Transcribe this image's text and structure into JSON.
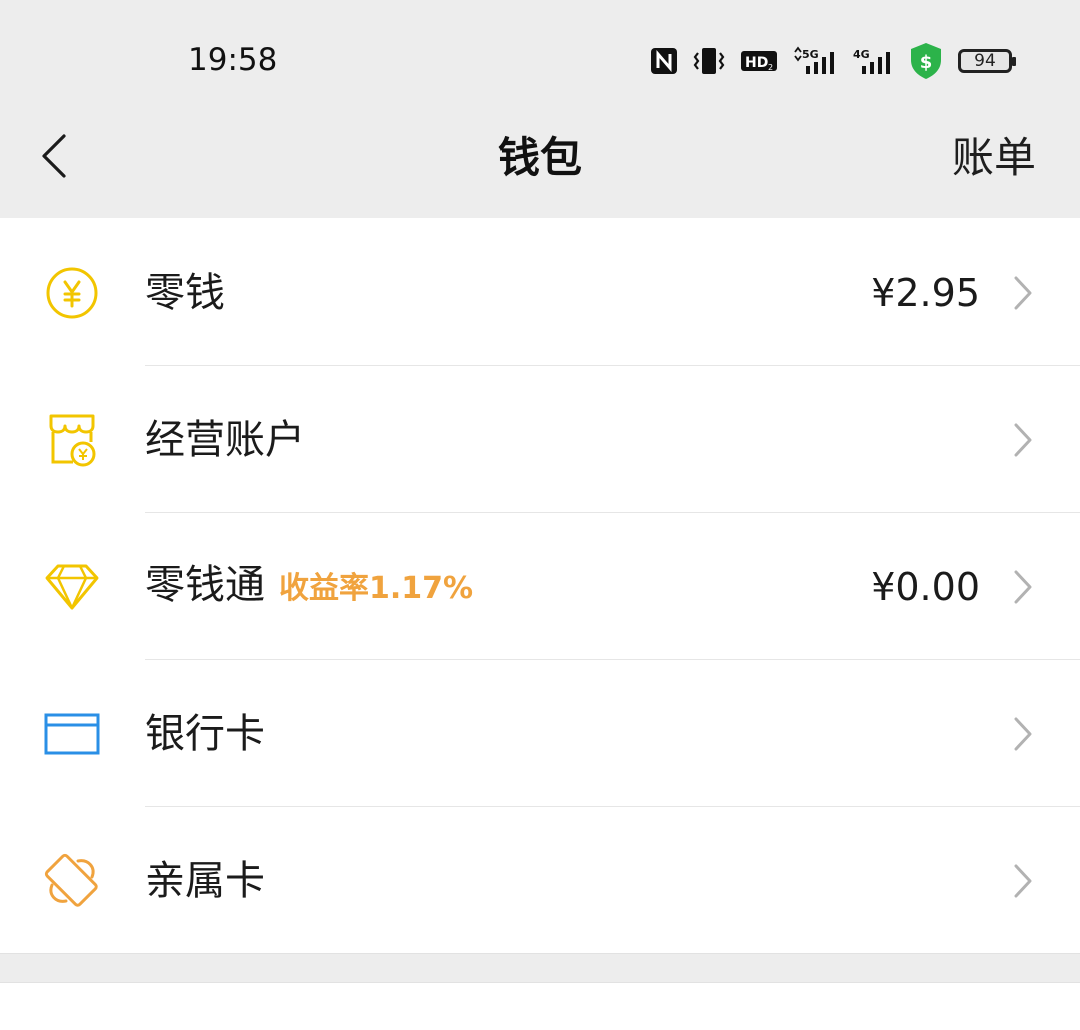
{
  "status_bar": {
    "time": "19:58",
    "icons": [
      "nfc-icon",
      "vibrate-icon",
      "hd-icon",
      "5g-signal-icon",
      "4g-signal-icon",
      "shield-dollar-icon",
      "battery-icon"
    ],
    "battery_level": "94",
    "shield_color": "#2cb34a"
  },
  "nav": {
    "title": "钱包",
    "right_action": "账单",
    "back_icon": "chevron-left-icon"
  },
  "items": [
    {
      "label": "零钱",
      "value": "¥2.95",
      "icon": "yuan-coin-icon",
      "icon_color": "#f2c500"
    },
    {
      "label": "经营账户",
      "value": "",
      "icon": "shop-account-icon",
      "icon_color": "#f2c500"
    },
    {
      "label": "零钱通",
      "tag": "收益率1.17%",
      "value": "¥0.00",
      "icon": "diamond-icon",
      "icon_color": "#f2c500",
      "tag_color": "#f0a33e"
    },
    {
      "label": "银行卡",
      "value": "",
      "icon": "bank-card-icon",
      "icon_color": "#2a8fe6"
    },
    {
      "label": "亲属卡",
      "value": "",
      "icon": "family-card-icon",
      "icon_color": "#f0a33e"
    }
  ],
  "colors": {
    "header_bg": "#ededed",
    "chevron": "#b2b2b2",
    "text": "#1b1b1b"
  }
}
